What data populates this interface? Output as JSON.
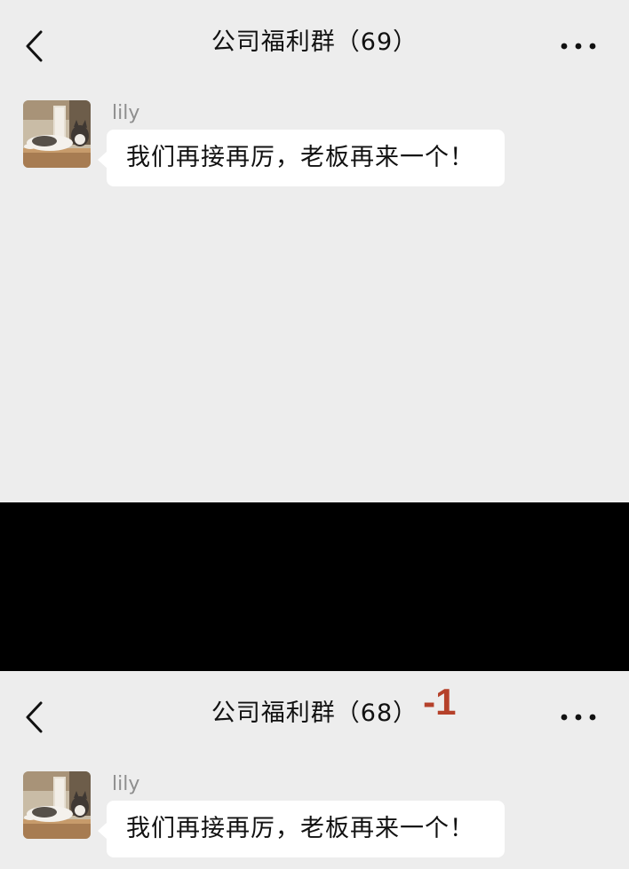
{
  "panels": {
    "before": {
      "title": "公司福利群（69）",
      "message": {
        "sender": "lily",
        "text": "我们再接再厉，老板再来一个！"
      }
    },
    "after": {
      "title": "公司福利群（68）",
      "delta": "-1",
      "message": {
        "sender": "lily",
        "text": "我们再接再厉，老板再来一个！"
      }
    }
  },
  "icons": {
    "back": "chevron-left-icon",
    "more": "more-dots-icon"
  },
  "colors": {
    "background": "#ededed",
    "bubble": "#ffffff",
    "divider": "#000000",
    "delta_highlight": "#b5412a",
    "sender_name": "#8e8e8e"
  }
}
